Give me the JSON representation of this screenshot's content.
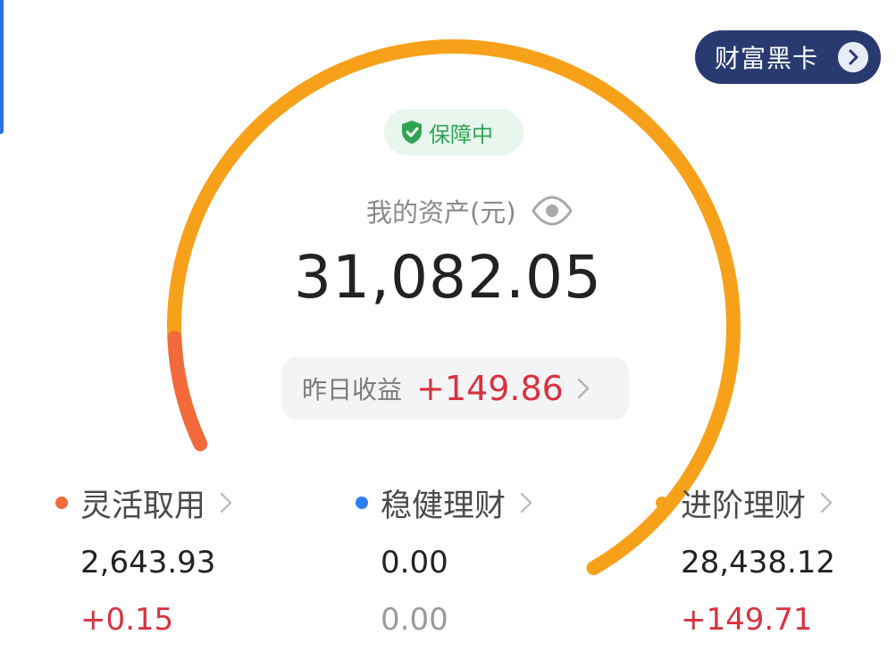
{
  "vip_card": {
    "label": "财富黑卡",
    "icon": "chevron-right-circle-icon"
  },
  "protection": {
    "label": "保障中",
    "icon": "shield-check-icon"
  },
  "assets": {
    "title": "我的资产(元)",
    "total": "31,082.05",
    "eye_icon": "eye-icon"
  },
  "yesterday": {
    "label": "昨日收益",
    "value": "+149.86",
    "icon": "chevron-right-icon"
  },
  "gauge": {
    "segments": [
      {
        "name": "灵活取用",
        "value": 2643.93,
        "color": "#f26a3b"
      },
      {
        "name": "稳健理财",
        "value": 0.0,
        "color": "#2d7cf6"
      },
      {
        "name": "进阶理财",
        "value": 28438.12,
        "color": "#f7a11b"
      }
    ]
  },
  "categories": [
    {
      "name": "灵活取用",
      "amount": "2,643.93",
      "delta": "+0.15",
      "dot_color": "#f26a3b",
      "delta_color": "#d8323f"
    },
    {
      "name": "稳健理财",
      "amount": "0.00",
      "delta": "0.00",
      "dot_color": "#2d7cf6",
      "delta_color": "#9a9a9a"
    },
    {
      "name": "进阶理财",
      "amount": "28,438.12",
      "delta": "+149.71",
      "dot_color": "#f7a11b",
      "delta_color": "#d8323f"
    }
  ]
}
